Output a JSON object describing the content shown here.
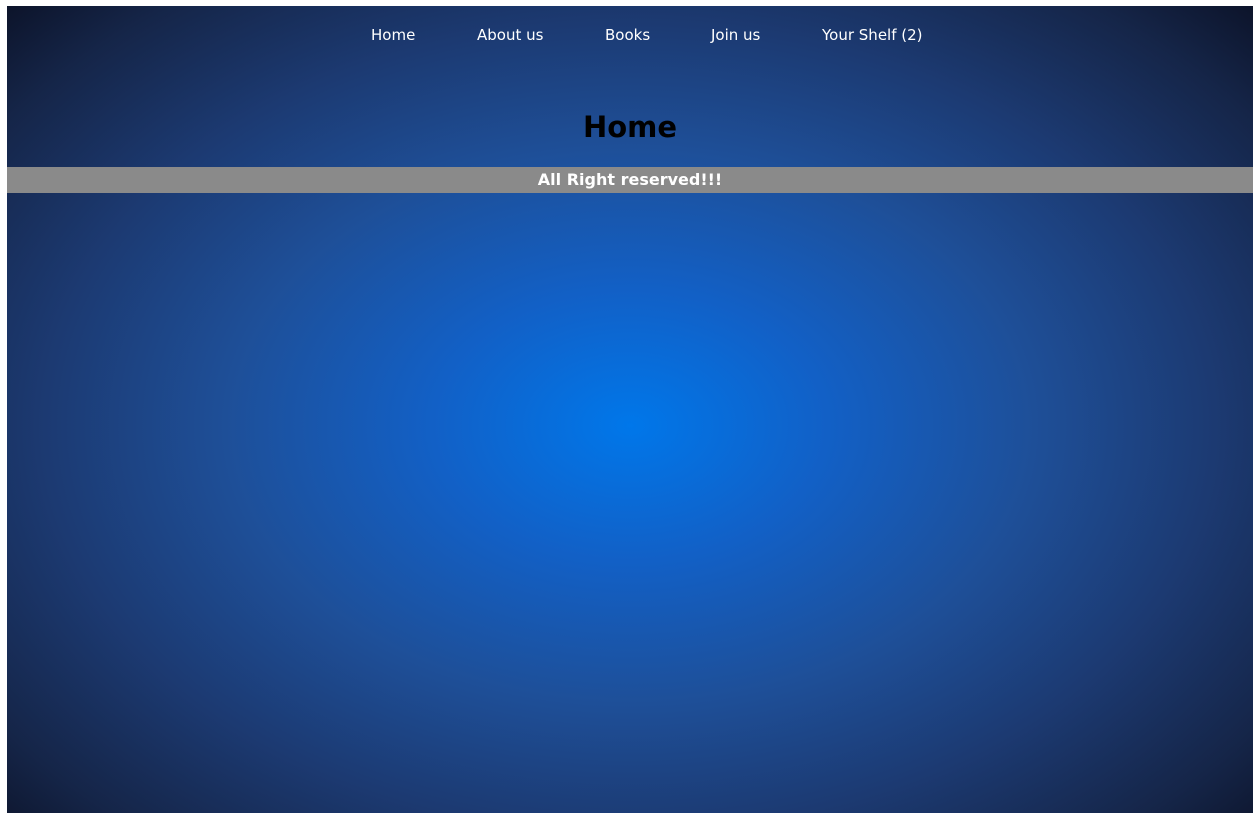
{
  "nav": {
    "items": [
      {
        "label": "Home"
      },
      {
        "label": "About us"
      },
      {
        "label": "Books"
      },
      {
        "label": "Join us"
      },
      {
        "label": "Your Shelf (2)"
      }
    ]
  },
  "main": {
    "title": "Home"
  },
  "footer": {
    "text": "All Right reserved!!!"
  },
  "colors": {
    "background_center": "#0077ea",
    "background_edge": "#0a0f22",
    "footer_bar": "#8a8a8a",
    "nav_text": "#ffffff",
    "title_text": "#000000"
  }
}
